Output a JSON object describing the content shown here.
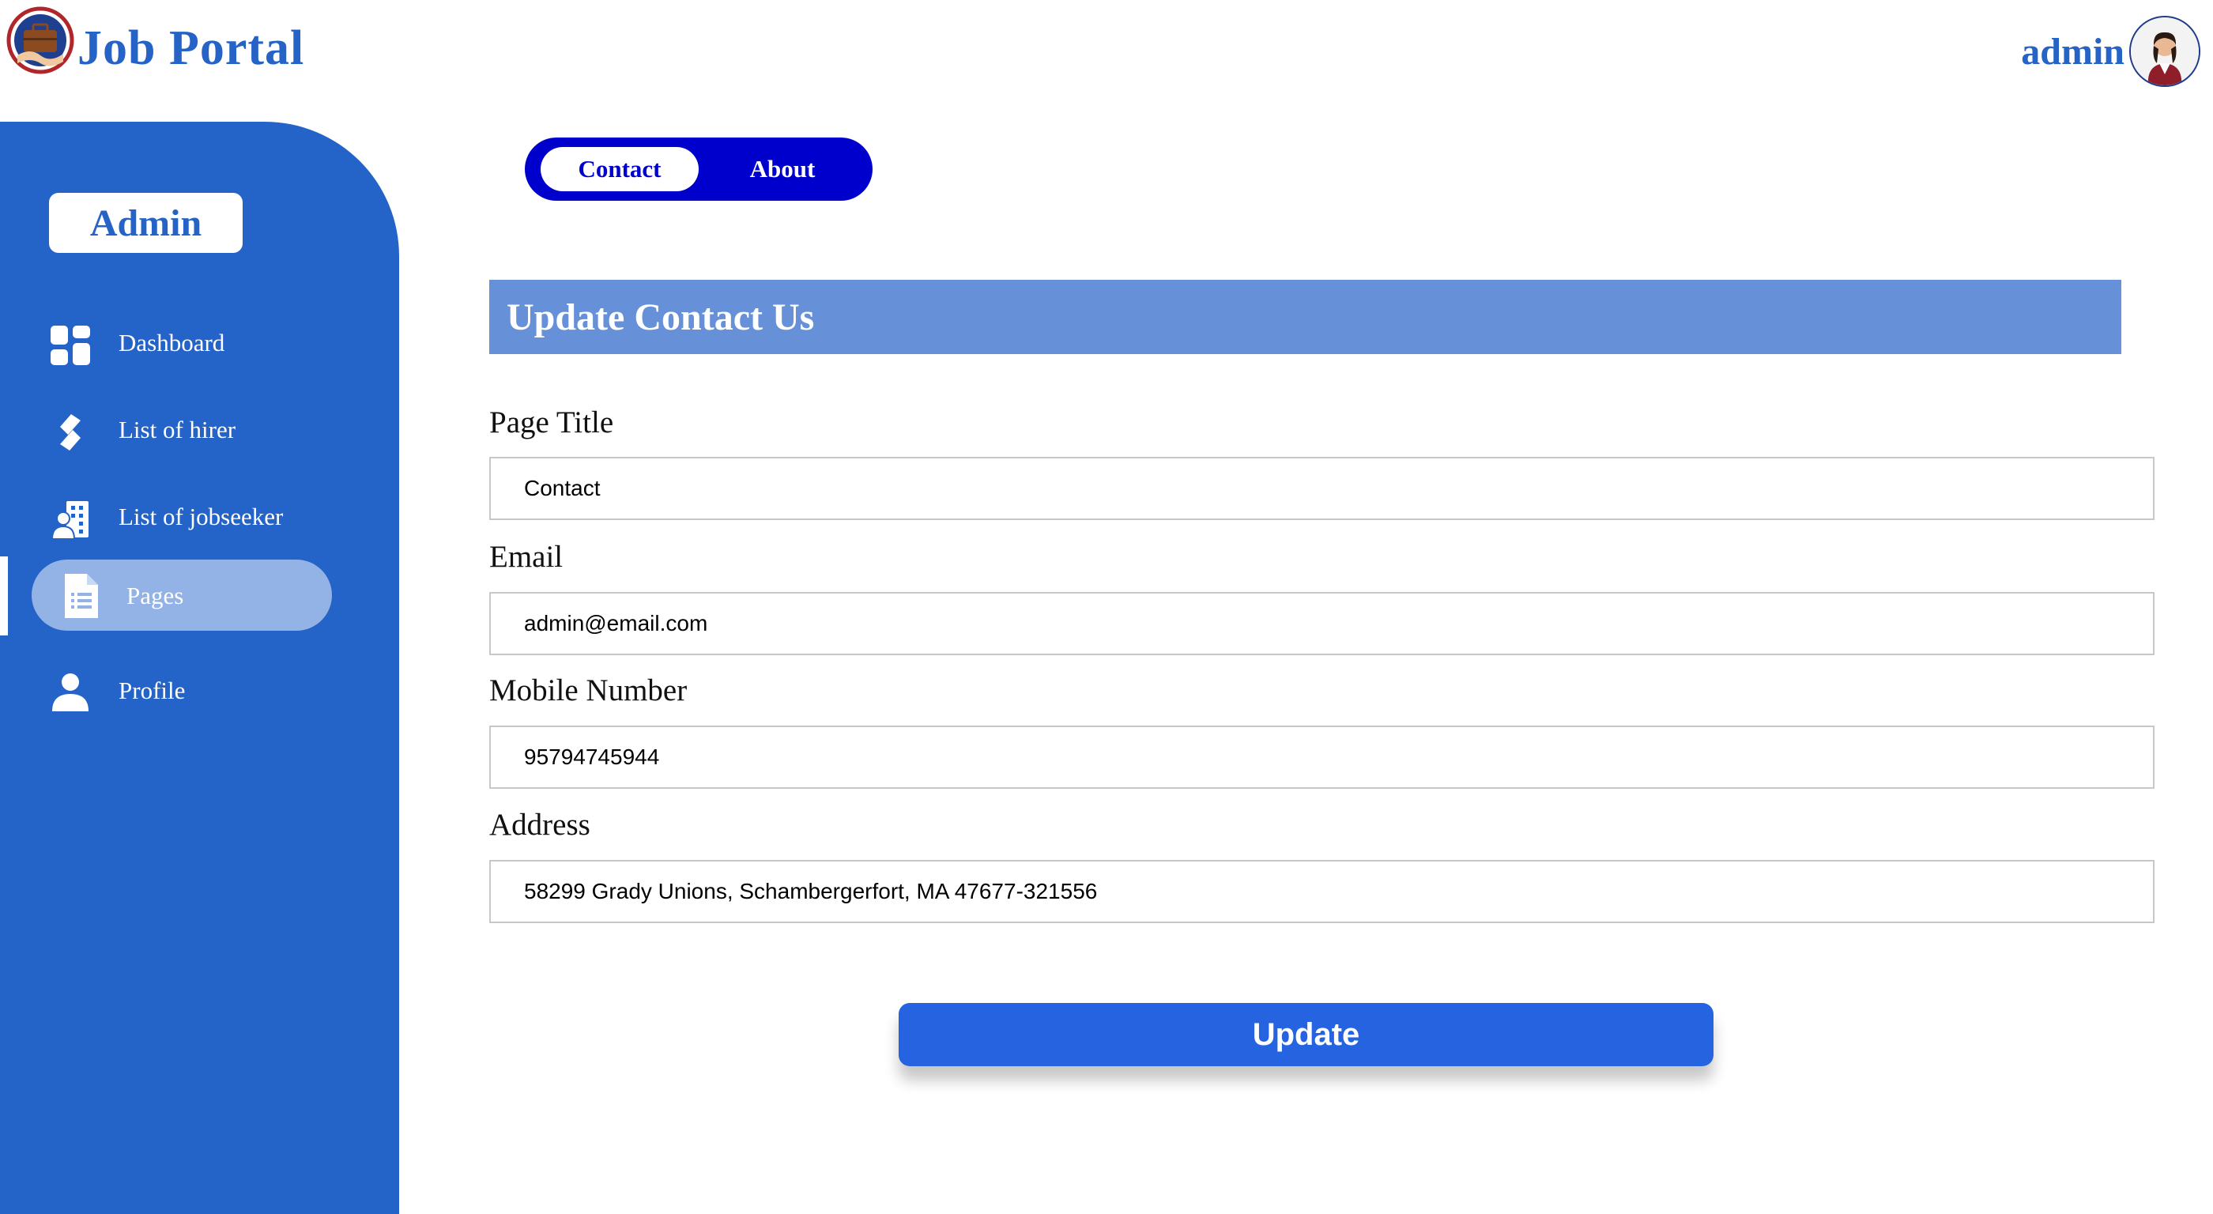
{
  "header": {
    "brand": "Job Portal",
    "user_name": "admin"
  },
  "sidebar": {
    "role": "Admin",
    "items": [
      {
        "label": "Dashboard",
        "icon": "dashboard-icon"
      },
      {
        "label": "List of hirer",
        "icon": "hirer-icon"
      },
      {
        "label": "List of jobseeker",
        "icon": "jobseeker-icon"
      },
      {
        "label": "Pages",
        "icon": "page-icon",
        "active": true
      },
      {
        "label": "Profile",
        "icon": "user-icon"
      }
    ]
  },
  "tabs": [
    {
      "label": "Contact",
      "active": true
    },
    {
      "label": "About",
      "active": false
    }
  ],
  "form": {
    "title": "Update Contact Us",
    "fields": [
      {
        "label": "Page Title",
        "value": "Contact"
      },
      {
        "label": "Email",
        "value": "admin@email.com"
      },
      {
        "label": "Mobile Number",
        "value": "95794745944"
      },
      {
        "label": "Address",
        "value": "58299 Grady Unions, Schambergerfort, MA 47677-321556"
      }
    ],
    "submit_label": "Update"
  },
  "colors": {
    "brand": "#2563c6",
    "sidebar": "#2463c7",
    "tab_bg": "#0000cd",
    "section_header": "#6691d9",
    "button": "#2563e0"
  }
}
